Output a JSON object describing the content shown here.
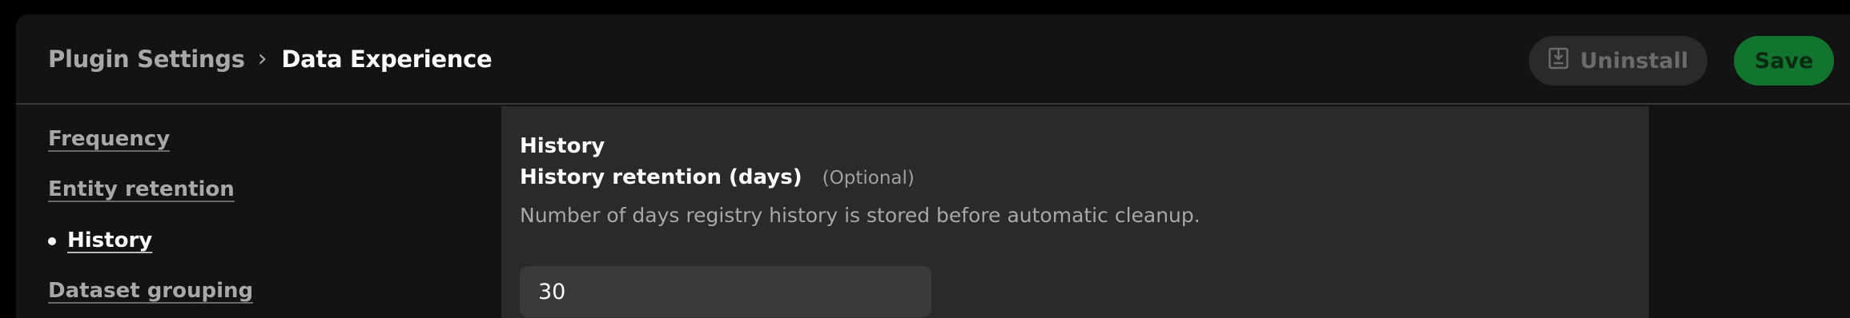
{
  "header": {
    "breadcrumb_parent": "Plugin Settings",
    "breadcrumb_separator": "›",
    "breadcrumb_current": "Data Experience",
    "uninstall_label": "Uninstall",
    "save_label": "Save"
  },
  "sidebar": {
    "items": [
      {
        "label": "Frequency",
        "active": false
      },
      {
        "label": "Entity retention",
        "active": false
      },
      {
        "label": "History",
        "active": true
      },
      {
        "label": "Dataset grouping",
        "active": false
      }
    ]
  },
  "panel": {
    "section_title": "History",
    "field_label": "History retention (days)",
    "field_optional": "(Optional)",
    "field_description": "Number of days registry history is stored before automatic cleanup.",
    "field_value": "30"
  },
  "colors": {
    "save_button": "#11742f",
    "background": "#131313",
    "panel": "#2a2a2a"
  },
  "icons": {
    "uninstall": "download-box-icon",
    "breadcrumb_separator": "chevron-right-icon"
  }
}
